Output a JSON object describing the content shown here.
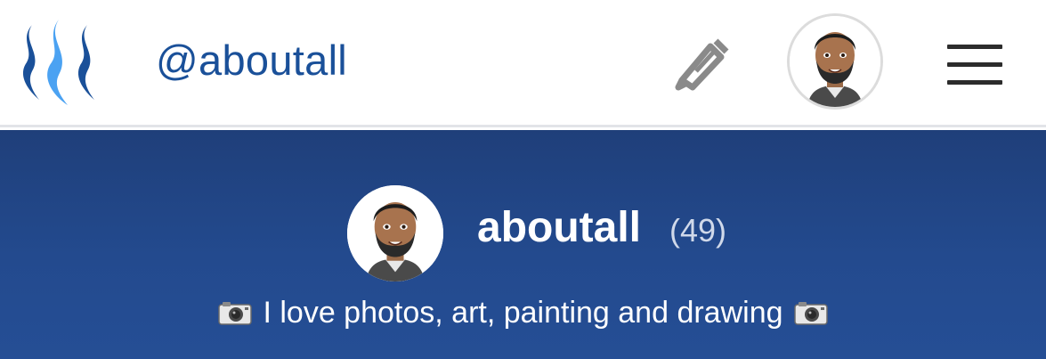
{
  "header": {
    "account_name": "@aboutall",
    "logo_icon": "steem-logo-icon",
    "compose_icon": "pencil-icon",
    "avatar_icon": "user-avatar-icon",
    "menu_icon": "hamburger-menu-icon"
  },
  "profile": {
    "name": "aboutall",
    "reputation": "(49)",
    "about": "I love photos, art, painting and drawing",
    "about_icon": "camera-icon"
  },
  "colors": {
    "brand_dark_blue": "#1a5099",
    "brand_light_blue": "#4ba2f2",
    "hero_background": "#234a8e",
    "header_background": "#ffffff",
    "header_text": "#1a5099"
  }
}
